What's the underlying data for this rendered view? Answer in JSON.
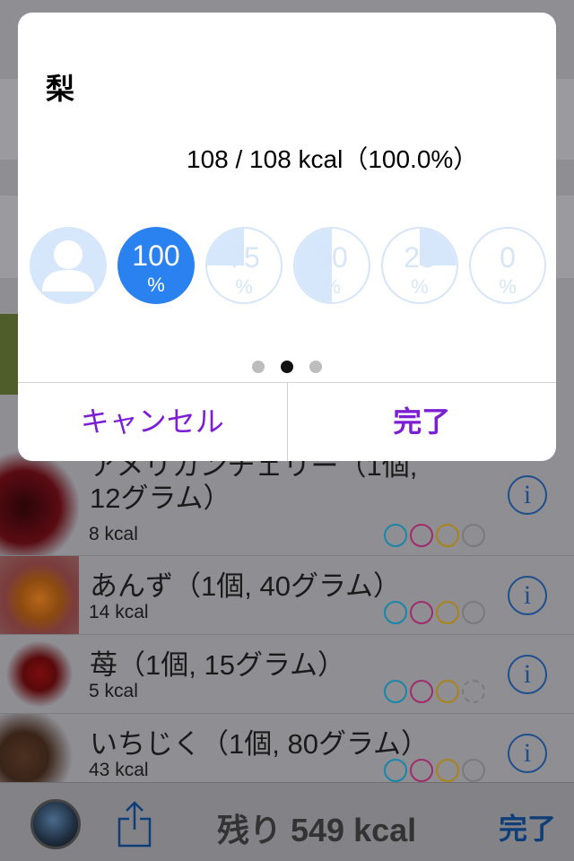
{
  "modal": {
    "title": "梨",
    "summary": "108 / 108 kcal（100.0%）",
    "portion_options": [
      {
        "number": "",
        "unit": "",
        "selected": false,
        "kind": "person"
      },
      {
        "number": "100",
        "unit": "%",
        "selected": true,
        "fill": 1.0
      },
      {
        "number": "75",
        "unit": "%",
        "selected": false,
        "fill": 0.75
      },
      {
        "number": "50",
        "unit": "%",
        "selected": false,
        "fill": 0.5
      },
      {
        "number": "25",
        "unit": "%",
        "selected": false,
        "fill": 0.25
      },
      {
        "number": "0",
        "unit": "%",
        "selected": false,
        "fill": 0.0
      }
    ],
    "pager": {
      "count": 3,
      "active": 1
    },
    "cancel_label": "キャンセル",
    "done_label": "完了"
  },
  "list": {
    "items": [
      {
        "name": "アメリカンチェリー（1個,",
        "name_line2": "12グラム）",
        "kcal": "8 kcal"
      },
      {
        "name": "あんず（1個, 40グラム）",
        "kcal": "14 kcal"
      },
      {
        "name": "苺（1個, 15グラム）",
        "kcal": "5 kcal"
      },
      {
        "name": "いちじく（1個, 80グラム）",
        "kcal": "43 kcal"
      }
    ]
  },
  "toolbar": {
    "remaining": "残り 549 kcal",
    "done_label": "完了"
  },
  "colors": {
    "accent_blue": "#2a82f0",
    "modal_action": "#7c1fd4",
    "dot_cyan": "#1a86a8",
    "dot_pink": "#a02c6c",
    "dot_yellow": "#a8841a"
  }
}
